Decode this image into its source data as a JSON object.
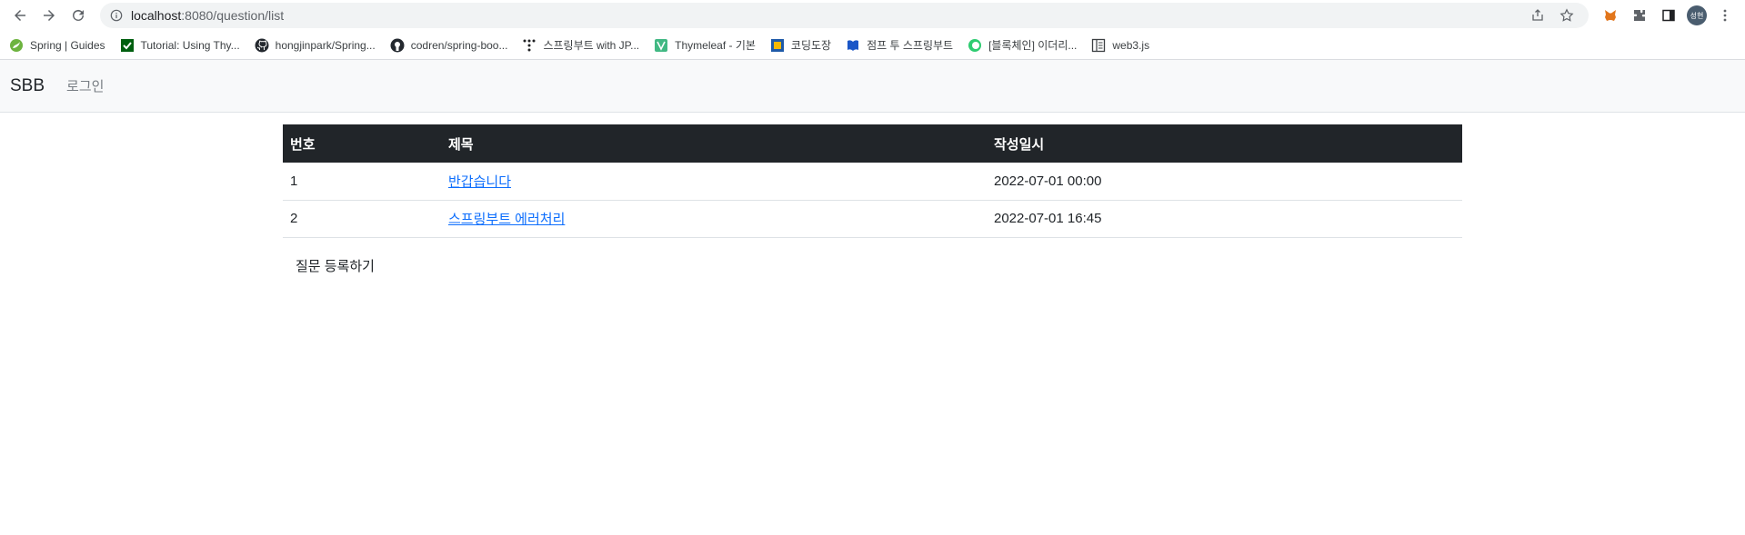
{
  "browser": {
    "url_host": "localhost",
    "url_rest": ":8080/question/list",
    "profile_initials": "성현",
    "bookmarks": [
      {
        "label": "Spring | Guides",
        "icon": "spring-leaf-icon"
      },
      {
        "label": "Tutorial: Using Thy...",
        "icon": "check-icon"
      },
      {
        "label": "hongjinpark/Spring...",
        "icon": "github-icon"
      },
      {
        "label": "codren/spring-boo...",
        "icon": "github-icon"
      },
      {
        "label": "스프링부트 with JP...",
        "icon": "dots-icon"
      },
      {
        "label": "Thymeleaf - 기본",
        "icon": "vuejs-icon"
      },
      {
        "label": "코딩도장",
        "icon": "dojo-icon"
      },
      {
        "label": "점프 투 스프링부트",
        "icon": "book-icon"
      },
      {
        "label": "[블록체인] 이더리...",
        "icon": "circle-icon"
      },
      {
        "label": "web3.js",
        "icon": "docs-icon"
      }
    ]
  },
  "navbar": {
    "brand": "SBB",
    "login": "로그인"
  },
  "table": {
    "headers": [
      "번호",
      "제목",
      "작성일시"
    ],
    "rows": [
      {
        "num": "1",
        "subject": "반갑습니다",
        "date": "2022-07-01 00:00"
      },
      {
        "num": "2",
        "subject": "스프링부트 에러처리",
        "date": "2022-07-01 16:45"
      }
    ]
  },
  "create_button": "질문 등록하기",
  "colors": {
    "table_header_bg": "#212529",
    "link": "#0d6efd",
    "navbar_bg": "#f8f9fa"
  }
}
